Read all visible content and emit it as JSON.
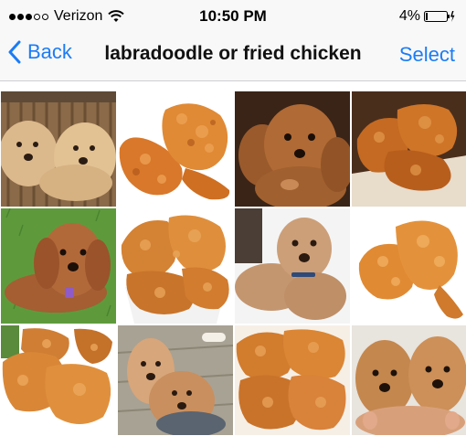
{
  "status_bar": {
    "carrier": "Verizon",
    "time": "10:50 PM",
    "battery_percent": "4%",
    "signal_bars_filled": 3,
    "signal_bars_total": 5
  },
  "nav": {
    "back_label": "Back",
    "title": "labradoodle or fried chicken",
    "select_label": "Select"
  },
  "colors": {
    "accent": "#1b7cf6"
  },
  "grid": {
    "tiles": [
      {
        "subject": "labradoodle"
      },
      {
        "subject": "fried chicken"
      },
      {
        "subject": "labradoodle"
      },
      {
        "subject": "fried chicken"
      },
      {
        "subject": "labradoodle"
      },
      {
        "subject": "fried chicken"
      },
      {
        "subject": "labradoodle"
      },
      {
        "subject": "fried chicken"
      },
      {
        "subject": "fried chicken"
      },
      {
        "subject": "labradoodle"
      },
      {
        "subject": "fried chicken"
      },
      {
        "subject": "labradoodle"
      }
    ]
  }
}
